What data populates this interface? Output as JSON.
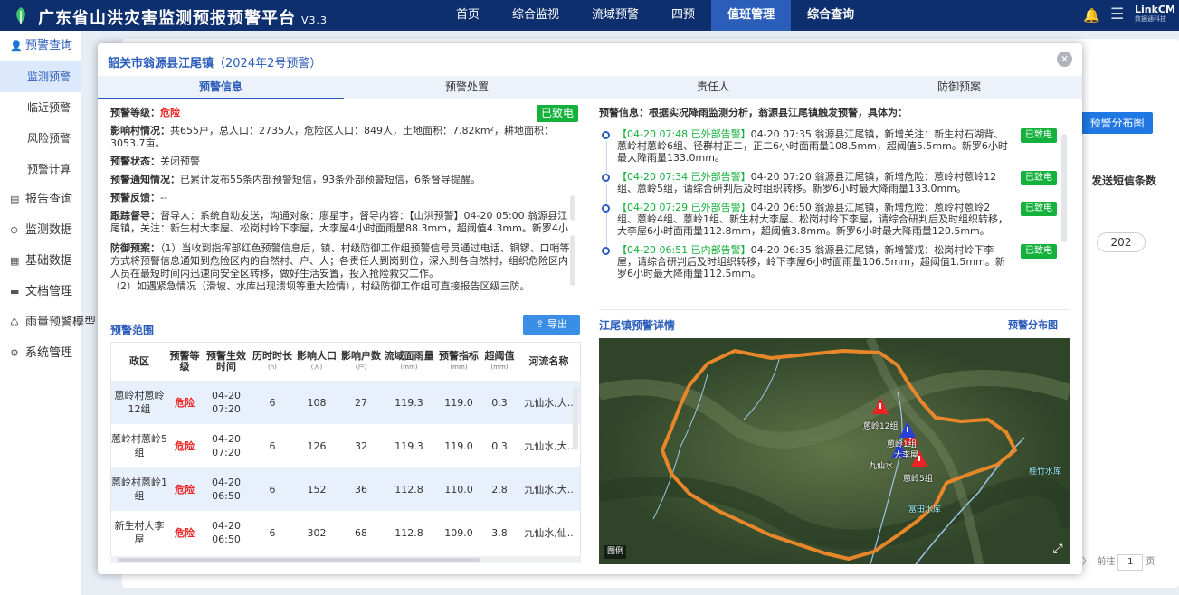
{
  "app": {
    "title": "广东省山洪灾害监测预报预警平台",
    "version": "V3.3",
    "brand": "LinkCM",
    "brand_sub": "数据通科技"
  },
  "nav": [
    "首页",
    "综合监视",
    "流域预警",
    "四预",
    "值班管理",
    "综合查询"
  ],
  "sidebar": {
    "group": "预警查询",
    "subitems": [
      "监测预警",
      "临近预警",
      "风险预警",
      "预警计算"
    ],
    "items": [
      "报告查询",
      "监测数据",
      "基础数据",
      "文档管理",
      "雨量预警模型",
      "系统管理"
    ]
  },
  "background": {
    "btn": "预警分布图",
    "col_header": "发送短信条数",
    "value": "202",
    "pager_prefix": "前往",
    "pager_page": "1",
    "pager_suffix": "页"
  },
  "modal": {
    "title": "韶关市翁源县江尾镇",
    "subtitle": "（2024年2号预警）",
    "tabs": [
      "预警信息",
      "预警处置",
      "责任人",
      "防御预案"
    ],
    "level_label": "预警等级：",
    "level_value": "危险",
    "called_tag": "已致电",
    "impact_label": "影响村情况：",
    "impact_text": "共655户，总人口：2735人，危险区人口：849人，土地面积：7.82km²，耕地面积：3053.7亩。",
    "status_label": "预警状态：",
    "status_value": "关闭预警",
    "notice_label": "预警通知情况：",
    "notice_text": "已累计发布55条内部预警短信，93条外部预警短信，6条督导提醒。",
    "feedback_label": "预警反馈：",
    "feedback_value": "--",
    "supervise_label": "跟踪督导：",
    "supervise_text": "督导人：系统自动发送，沟通对象：廖星宇，督导内容：【山洪预警】04-20 05:00 翁源县江尾镇，关注：新生村大李屋、松岗村岭下李屋，大李屋4小时面雨量88.3mm，超阈值4.3mm。新罗4小时最大降雨92.5mm，请及时处置，并加强值班！",
    "plan_label": "防御预案：",
    "plan_text1": "（1）当收到指挥部红色预警信息后，镇、村级防御工作组预警信号员通过电话、铜锣、口哨等方式将预警信息通知到危险区内的自然村、户、人；各责任人到岗到位，深入到各自然村，组织危险区内人员在最短时间内迅速向安全区转移，做好生活安置，投入抢险救灾工作。",
    "plan_text2": "（2）如遇紧急情况（滑坡、水库出现溃坝等重大险情），村级防御工作组可直接报告区级三防。",
    "range_title": "预警范围",
    "export_label": "导出",
    "info_header": "预警信息：根据实况降雨监测分析，翁源县江尾镇触发预警，具体为：",
    "detail_title": "江尾镇预警详情",
    "detail_link": "预警分布图",
    "legend": "图例"
  },
  "timeline": [
    {
      "time": "【04-20 07:48  已外部告警】",
      "text": "04-20 07:35 翁源县江尾镇，新增关注：新生村石湖背、蒽岭村蒽岭6组、径群村正二，正二6小时面雨量108.5mm，超阈值5.5mm。新罗6小时最大降雨量133.0mm。",
      "tag": "已致电"
    },
    {
      "time": "【04-20 07:34  已外部告警】",
      "text": "04-20 07:20 翁源县江尾镇，新增危险：蒽岭村蒽岭12组、蒽岭5组，请综合研判后及时组织转移。新罗6小时最大降雨量133.0mm。",
      "tag": "已致电"
    },
    {
      "time": "【04-20 07:29  已外部告警】",
      "text": "04-20 06:50 翁源县江尾镇，新增危险：蒽岭村蒽岭2组、蒽岭4组、蒽岭1组、新生村大李屋、松岗村岭下李屋，请综合研判后及时组织转移，大李屋6小时面雨量112.8mm，超阈值3.8mm。新罗6小时最大降雨量120.5mm。",
      "tag": "已致电"
    },
    {
      "time": "【04-20 06:51  已内部告警】",
      "text": "04-20 06:35 翁源县江尾镇，新增警戒：松岗村岭下李屋，请综合研判后及时组织转移，岭下李屋6小时面雨量106.5mm，超阈值1.5mm。新罗6小时最大降雨量112.5mm。",
      "tag": "已致电"
    }
  ],
  "table": {
    "headers": [
      {
        "t": "政区",
        "u": ""
      },
      {
        "t": "预警等级",
        "u": ""
      },
      {
        "t": "预警生效时间",
        "u": ""
      },
      {
        "t": "历时时长",
        "u": "(h)"
      },
      {
        "t": "影响人口",
        "u": "(人)"
      },
      {
        "t": "影响户数",
        "u": "(户)"
      },
      {
        "t": "流域面雨量",
        "u": "(mm)"
      },
      {
        "t": "预警指标",
        "u": "(mm)"
      },
      {
        "t": "超阈值",
        "u": "(mm)"
      },
      {
        "t": "河流名称",
        "u": ""
      }
    ],
    "rows": [
      [
        "蒽岭村蒽岭12组",
        "危险",
        "04-20 07:20",
        "6",
        "108",
        "27",
        "119.3",
        "119.0",
        "0.3",
        "九仙水,大.."
      ],
      [
        "蒽岭村蒽岭5组",
        "危险",
        "04-20 07:20",
        "6",
        "126",
        "32",
        "119.3",
        "119.0",
        "0.3",
        "九仙水,大.."
      ],
      [
        "蒽岭村蒽岭1组",
        "危险",
        "04-20 06:50",
        "6",
        "152",
        "36",
        "112.8",
        "110.0",
        "2.8",
        "九仙水,大.."
      ],
      [
        "新生村大李屋",
        "危险",
        "04-20 06:50",
        "6",
        "302",
        "68",
        "112.8",
        "109.0",
        "3.8",
        "九仙水,仙.."
      ]
    ]
  },
  "map_labels": [
    "桂竹水库",
    "蒽岭12组",
    "蒽岭1组",
    "大李屋",
    "九仙水",
    "蒽岭5组",
    "富田水库"
  ]
}
